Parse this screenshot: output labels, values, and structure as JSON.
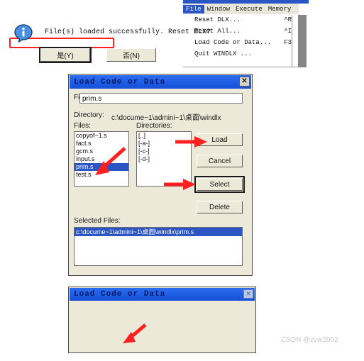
{
  "menu_window": {
    "menubar": [
      {
        "label": "File",
        "active": true
      },
      {
        "label": "Window",
        "active": false
      },
      {
        "label": "Execute",
        "active": false
      },
      {
        "label": "Memory",
        "active": false
      }
    ],
    "dropdown": [
      {
        "label": "Reset DLX...",
        "accel": "^R",
        "highlighted": false
      },
      {
        "label": "Reset All...",
        "accel": "^I",
        "highlighted": false
      },
      {
        "label": "Load Code or Data...",
        "accel": "F3",
        "highlighted": true
      },
      {
        "label": "Quit WINDLX ...",
        "accel": "",
        "highlighted": false
      }
    ]
  },
  "load_dialog": {
    "title": "Load Code or Data",
    "close_label": "✕",
    "filename_label": "Filename:",
    "filename_value": "prim.s",
    "directory_label": "Directory:",
    "directory_value": "c:\\docume~1\\admini~1\\桌面\\windlx",
    "files_label": "Files:",
    "directories_label": "Directories:",
    "files": [
      {
        "name": "copyof~1.s",
        "selected": false
      },
      {
        "name": "fact.s",
        "selected": false
      },
      {
        "name": "gcm.s",
        "selected": false
      },
      {
        "name": "input.s",
        "selected": false
      },
      {
        "name": "prim.s",
        "selected": true
      },
      {
        "name": "test.s",
        "selected": false
      }
    ],
    "directories": [
      {
        "name": "[..]"
      },
      {
        "name": "[-a-]"
      },
      {
        "name": "[-c-]"
      },
      {
        "name": "[-d-]"
      }
    ],
    "buttons": {
      "load": "Load",
      "cancel": "Cancel",
      "select": "Select",
      "delete": "Delete"
    },
    "selected_files_label": "Selected Files:",
    "selected_files": [
      "c:\\docume~1\\admini~1\\桌面\\windlx\\prim.s"
    ]
  },
  "message_dialog": {
    "title": "Load Code or Data",
    "close_label": "✕",
    "icon": "info-icon",
    "message": "File(s) loaded successfully. Reset DLX?",
    "yes_label": "是(Y)",
    "no_label": "否(N)"
  },
  "annotations": {
    "accent_color": "#ff2020",
    "highlight_color": "#2b55c4",
    "watermark": "CSDN @zyw2002"
  }
}
